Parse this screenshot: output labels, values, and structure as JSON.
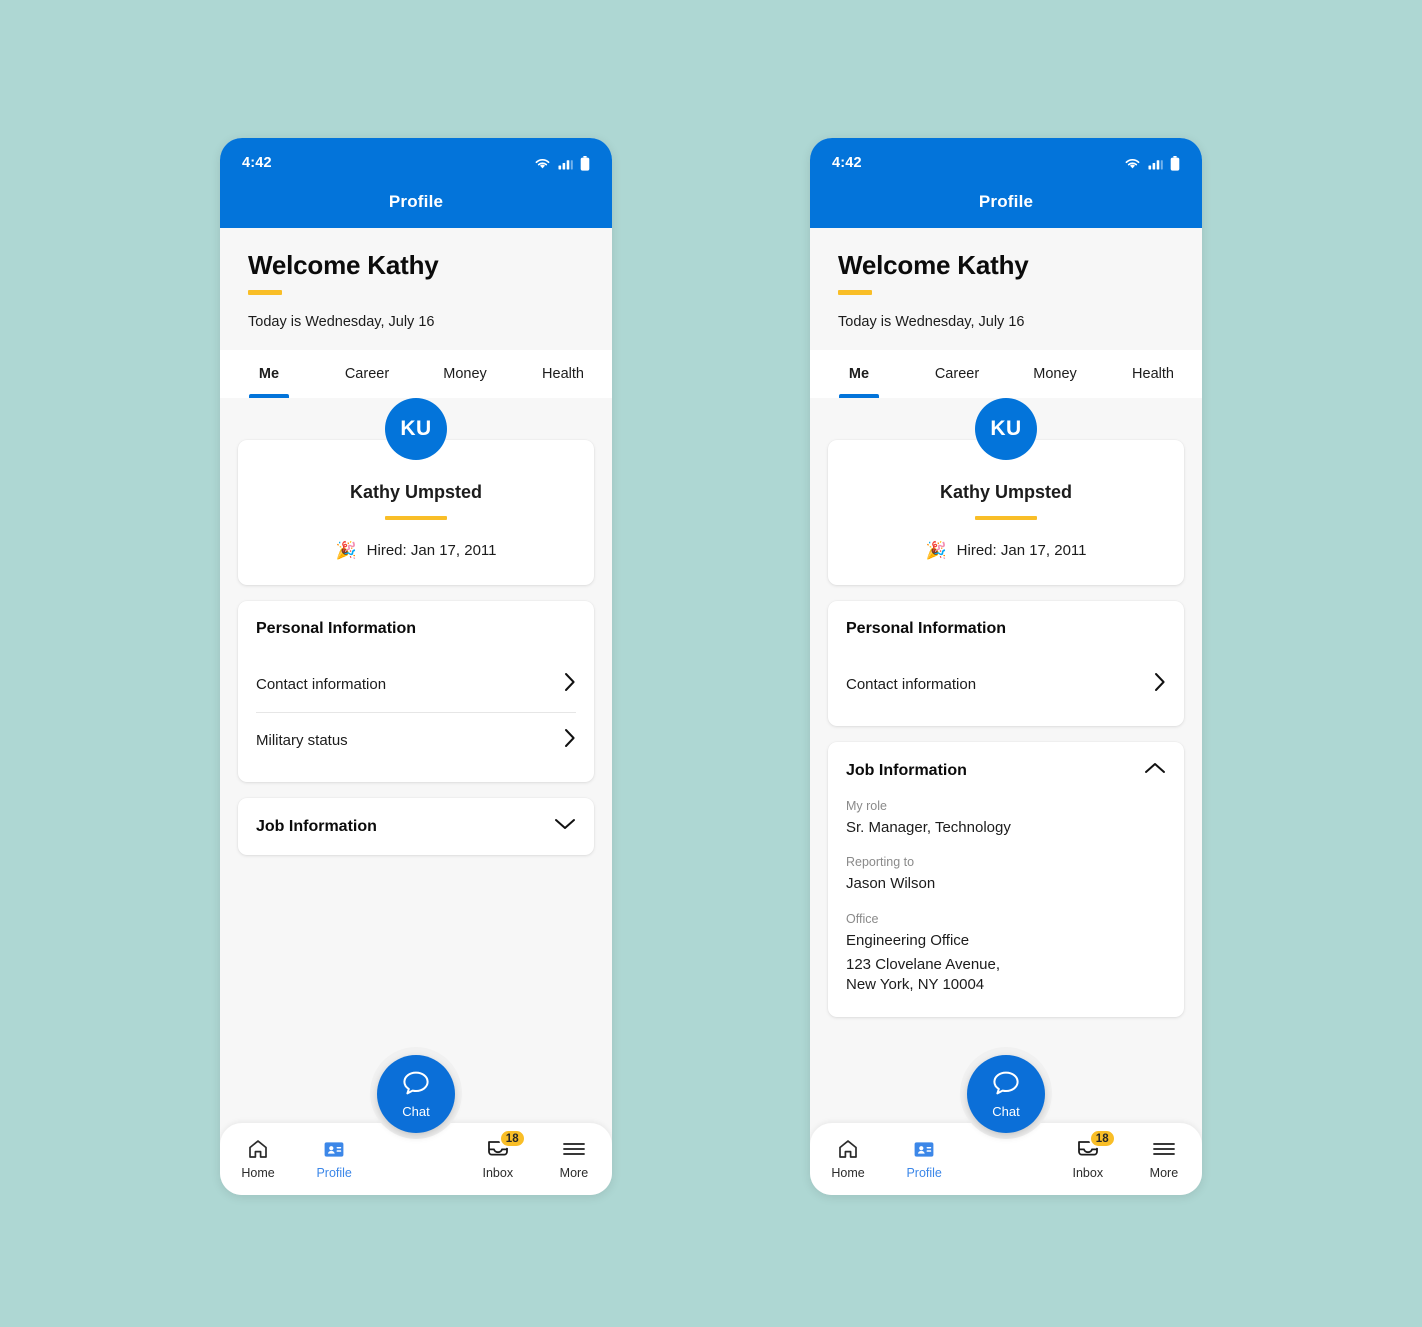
{
  "background_color": "#aed7d3",
  "accent_blue": "#0374da",
  "accent_yellow": "#f9be27",
  "status_bar": {
    "time": "4:42",
    "icons": [
      "wifi-icon",
      "cellular-signal-icon",
      "battery-icon"
    ]
  },
  "app_bar": {
    "title": "Profile"
  },
  "welcome": {
    "title": "Welcome Kathy",
    "subtitle": "Today is Wednesday, July 16"
  },
  "tabs": [
    {
      "label": "Me",
      "active": true
    },
    {
      "label": "Career",
      "active": false
    },
    {
      "label": "Money",
      "active": false
    },
    {
      "label": "Health",
      "active": false
    }
  ],
  "profile_card": {
    "avatar_initials": "KU",
    "name": "Kathy Umpsted",
    "hired_emoji": "🎉",
    "hired_text": "Hired: Jan 17, 2011"
  },
  "personal_information": {
    "title": "Personal Information",
    "rows_left": [
      {
        "label": "Contact information",
        "icon": "chevron-right-icon"
      },
      {
        "label": "Military status",
        "icon": "chevron-right-icon"
      }
    ],
    "rows_right": [
      {
        "label": "Contact information",
        "icon": "chevron-right-icon"
      }
    ]
  },
  "job_information": {
    "title": "Job Information",
    "collapsed_icon": "chevron-down-icon",
    "expanded_icon": "chevron-up-icon",
    "fields": [
      {
        "label": "My role",
        "value": "Sr. Manager, Technology"
      },
      {
        "label": "Reporting to",
        "value": "Jason Wilson"
      },
      {
        "label": "Office",
        "value": "Engineering Office",
        "address_line1": "123 Clovelane Avenue,",
        "address_line2": "New York, NY 10004"
      }
    ]
  },
  "bottom_nav": {
    "items": [
      {
        "label": "Home",
        "icon": "home-icon",
        "active": false
      },
      {
        "label": "Profile",
        "icon": "id-card-icon",
        "active": true
      },
      {
        "label": "Inbox",
        "icon": "inbox-tray-icon",
        "active": false,
        "badge": "18"
      },
      {
        "label": "More",
        "icon": "hamburger-menu-icon",
        "active": false
      }
    ],
    "fab": {
      "label": "Chat",
      "icon": "chat-bubble-icon"
    }
  }
}
